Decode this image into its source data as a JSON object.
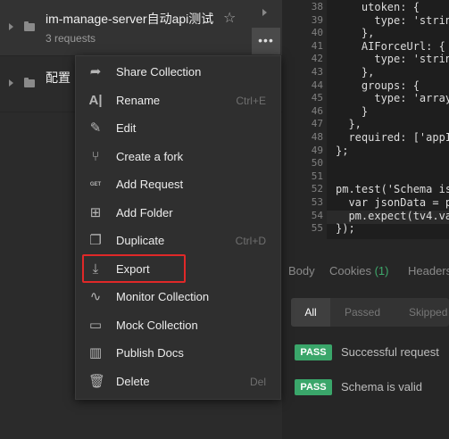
{
  "sidebar": {
    "collections": [
      {
        "title": "im-manage-server自动api测试",
        "subtitle": "3 requests"
      },
      {
        "title": "配置"
      }
    ],
    "more_label": "•••"
  },
  "context_menu": {
    "items": [
      {
        "label": "Share Collection",
        "shortcut": "",
        "icon": "share-icon"
      },
      {
        "label": "Rename",
        "shortcut": "Ctrl+E",
        "icon": "rename-icon"
      },
      {
        "label": "Edit",
        "shortcut": "",
        "icon": "pencil-icon"
      },
      {
        "label": "Create a fork",
        "shortcut": "",
        "icon": "fork-icon"
      },
      {
        "label": "Add Request",
        "shortcut": "",
        "icon": "get-request-icon"
      },
      {
        "label": "Add Folder",
        "shortcut": "",
        "icon": "add-folder-icon"
      },
      {
        "label": "Duplicate",
        "shortcut": "Ctrl+D",
        "icon": "duplicate-icon"
      },
      {
        "label": "Export",
        "shortcut": "",
        "icon": "download-icon"
      },
      {
        "label": "Monitor Collection",
        "shortcut": "",
        "icon": "monitor-icon"
      },
      {
        "label": "Mock Collection",
        "shortcut": "",
        "icon": "server-icon"
      },
      {
        "label": "Publish Docs",
        "shortcut": "",
        "icon": "docs-icon"
      },
      {
        "label": "Delete",
        "shortcut": "Del",
        "icon": "trash-icon"
      }
    ],
    "highlighted": "Export",
    "highlight_color": "#e02828"
  },
  "editor": {
    "lines": [
      {
        "n": "38",
        "text": "    utoken: {"
      },
      {
        "n": "39",
        "text": "      type: 'strin"
      },
      {
        "n": "40",
        "text": "    },"
      },
      {
        "n": "41",
        "text": "    AIForceUrl: {"
      },
      {
        "n": "42",
        "text": "      type: 'strin"
      },
      {
        "n": "43",
        "text": "    },"
      },
      {
        "n": "44",
        "text": "    groups: {"
      },
      {
        "n": "45",
        "text": "      type: 'array"
      },
      {
        "n": "46",
        "text": "    }"
      },
      {
        "n": "47",
        "text": "  },"
      },
      {
        "n": "48",
        "text": "  required: ['appI"
      },
      {
        "n": "49",
        "text": "};"
      },
      {
        "n": "50",
        "text": ""
      },
      {
        "n": "51",
        "text": ""
      },
      {
        "n": "52",
        "text": "pm.test('Schema is"
      },
      {
        "n": "53",
        "text": "  var jsonData = p"
      },
      {
        "n": "54",
        "text": "  pm.expect(tv4.va"
      },
      {
        "n": "55",
        "text": "});"
      }
    ]
  },
  "response": {
    "tabs": [
      "Body",
      "Cookies",
      "Headers"
    ],
    "cookies_count": "(1)",
    "filters": [
      "All",
      "Passed",
      "Skipped"
    ],
    "tests": [
      {
        "status": "PASS",
        "name": "Successful request"
      },
      {
        "status": "PASS",
        "name": "Schema is valid"
      }
    ],
    "pass_color": "#3aa66a"
  }
}
